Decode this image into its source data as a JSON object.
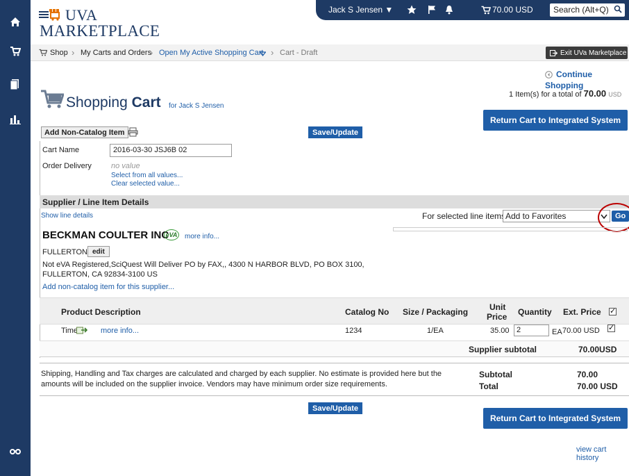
{
  "app": {
    "logo_line1": "UVA",
    "logo_line2": "MARKETPLACE"
  },
  "topbar": {
    "user_name": "Jack S Jensen ▼",
    "cart_total": "70.00 USD",
    "search_placeholder": "Search (Alt+Q)"
  },
  "breadcrumb": {
    "shop": "Shop",
    "carts": "My Carts and Orders",
    "active": "Open My Active Shopping Cart",
    "current": "Cart - Draft",
    "exit_label": "Exit UVa Marketplace"
  },
  "page": {
    "continue_shopping": "Continue Shopping",
    "summary_prefix": "1 Item(s)  for a total of",
    "summary_total": "70.00",
    "summary_currency": "USD",
    "title_light": "Shopping",
    "title_bold": "Cart",
    "for_user": "for Jack S Jensen",
    "return_label": "Return Cart to Integrated System",
    "add_noncatalog": "Add Non-Catalog Item",
    "save_update": "Save/Update"
  },
  "cart_info": {
    "cart_name_label": "Cart Name",
    "cart_name_value": "2016-03-30 JSJ6B 02",
    "order_delivery_label": "Order Delivery",
    "no_value": "no value",
    "select_all": "Select from all values...",
    "clear_selected": "Clear selected value..."
  },
  "supplier_section": {
    "title": "Supplier / Line Item Details",
    "show_details": "Show line details",
    "for_selected": "For selected line items",
    "action_value": "Add to Favorites",
    "go": "Go",
    "supplier_name": "BECKMAN COULTER INC",
    "eva_badge": "eVA",
    "more_info": "more info...",
    "location": "FULLERTON",
    "edit": "edit",
    "address1": "Not eVA Registered,SciQuest Will Deliver PO by FAX,, 4300 N HARBOR BLVD, PO BOX 3100,",
    "address2": "FULLERTON, CA 92834-3100 US",
    "add_noncatalog_supplier": "Add non-catalog item for this supplier..."
  },
  "table": {
    "headers": {
      "product": "Product Description",
      "catalog": "Catalog No",
      "size": "Size / Packaging",
      "unit_price_1": "Unit",
      "unit_price_2": "Price",
      "quantity": "Quantity",
      "ext_price": "Ext. Price"
    },
    "row": {
      "product": "Timer",
      "more_info": "more info...",
      "catalog": "1234",
      "size": "1/EA",
      "unit_price": "35.00",
      "quantity": "2",
      "unit": "EA",
      "ext_price": "70.00 USD"
    },
    "supplier_subtotal_label": "Supplier subtotal",
    "supplier_subtotal_value": "70.00USD"
  },
  "totals": {
    "notes_line1": "Shipping, Handling and Tax charges are calculated and charged by each supplier. No estimate is provided here but the",
    "notes_line2": "amounts will be included on the supplier invoice. Vendors may have minimum order size requirements.",
    "subtotal_label": "Subtotal",
    "subtotal_value": "70.00",
    "total_label": "Total",
    "total_value": "70.00 USD"
  },
  "footer": {
    "view_history": "view cart history"
  },
  "colors": {
    "navy": "#1e3a64",
    "link": "#1f5ea8",
    "annotation_circle": "#b00000"
  }
}
